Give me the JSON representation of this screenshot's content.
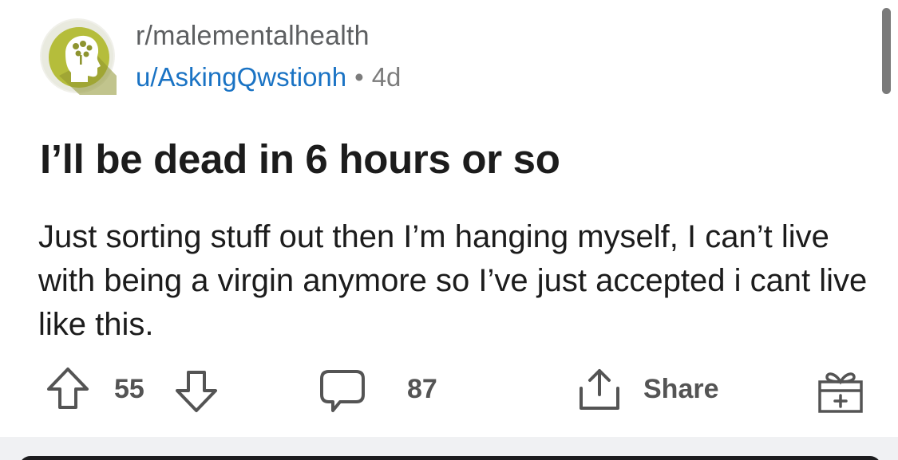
{
  "post": {
    "subreddit": "r/malementalhealth",
    "username": "u/AskingQwstionh",
    "separator": "•",
    "age": "4d",
    "title": "I’ll be dead in 6 hours or so",
    "body": "Just sorting stuff out then I’m hanging myself, I can’t live with being a virgin anymore so I’ve just accepted i cant live like this."
  },
  "actions": {
    "upvotes": "55",
    "comments": "87",
    "share_label": "Share"
  },
  "icons": {
    "avatar": "brain-head-icon",
    "upvote": "arrow-up-icon",
    "downvote": "arrow-down-icon",
    "comment": "comment-bubble-icon",
    "share": "share-icon",
    "award": "gift-award-icon"
  },
  "colors": {
    "username": "#1a73c4",
    "avatar_bg": "#b5bd3b",
    "text": "#1c1c1c",
    "muted": "#7c7c7c"
  }
}
